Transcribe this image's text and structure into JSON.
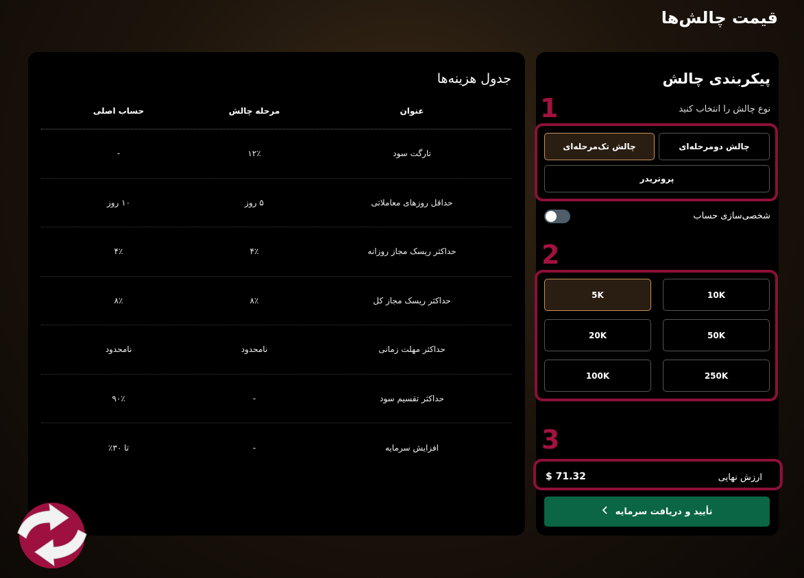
{
  "page_title": "قیمت چالش‌ها",
  "config": {
    "title": "پیکربندی چالش",
    "subtitle": "نوع چالش را انتخاب کنید",
    "steps": [
      "1",
      "2",
      "3"
    ],
    "challenge_types": [
      {
        "label": "چالش دومرحله‌ای",
        "active": false
      },
      {
        "label": "چالش تک‌مرحله‌ای",
        "active": true
      },
      {
        "label": "پروتریدر",
        "active": false
      }
    ],
    "customize_label": "شخصی‌سازی حساب",
    "customize_enabled": false,
    "amounts": [
      {
        "label": "10K",
        "active": false
      },
      {
        "label": "5K",
        "active": true
      },
      {
        "label": "50K",
        "active": false
      },
      {
        "label": "20K",
        "active": false
      },
      {
        "label": "250K",
        "active": false
      },
      {
        "label": "100K",
        "active": false
      }
    ],
    "final_label": "ارزش نهایی",
    "final_value": "$ 71.32",
    "cta_label": "تأیید و دریافت سرمایه",
    "cta_icon": "chevron-left-icon"
  },
  "fees": {
    "title": "جدول هزینه‌ها",
    "headers": {
      "title": "عنوان",
      "stage": "مرحله چالش",
      "real": "حساب اصلی"
    },
    "rows": [
      {
        "title": "تارگت سود",
        "stage": "۱۲٪",
        "real": "-"
      },
      {
        "title": "حداقل روزهای معاملاتی",
        "stage": "۵ روز",
        "real": "۱۰ روز"
      },
      {
        "title": "حداکثر ریسک مجاز روزانه",
        "stage": "۴٪",
        "real": "۴٪"
      },
      {
        "title": "حداکثر ریسک مجاز کل",
        "stage": "۸٪",
        "real": "۸٪"
      },
      {
        "title": "حداکثر مهلت زمانی",
        "stage": "نامحدود",
        "real": "نامحدود"
      },
      {
        "title": "حداکثر تقسیم سود",
        "stage": "-",
        "real": "۹۰٪"
      },
      {
        "title": "افزایش سرمایه",
        "stage": "-",
        "real": "تا ۳۰٪"
      }
    ]
  },
  "colors": {
    "highlight": "#8c1038",
    "step_number": "#a3123f",
    "cta": "#0a6645",
    "active_border": "#c9945a",
    "logo_red": "#9e1040"
  },
  "logo_icon": "swap-arrows-logo"
}
